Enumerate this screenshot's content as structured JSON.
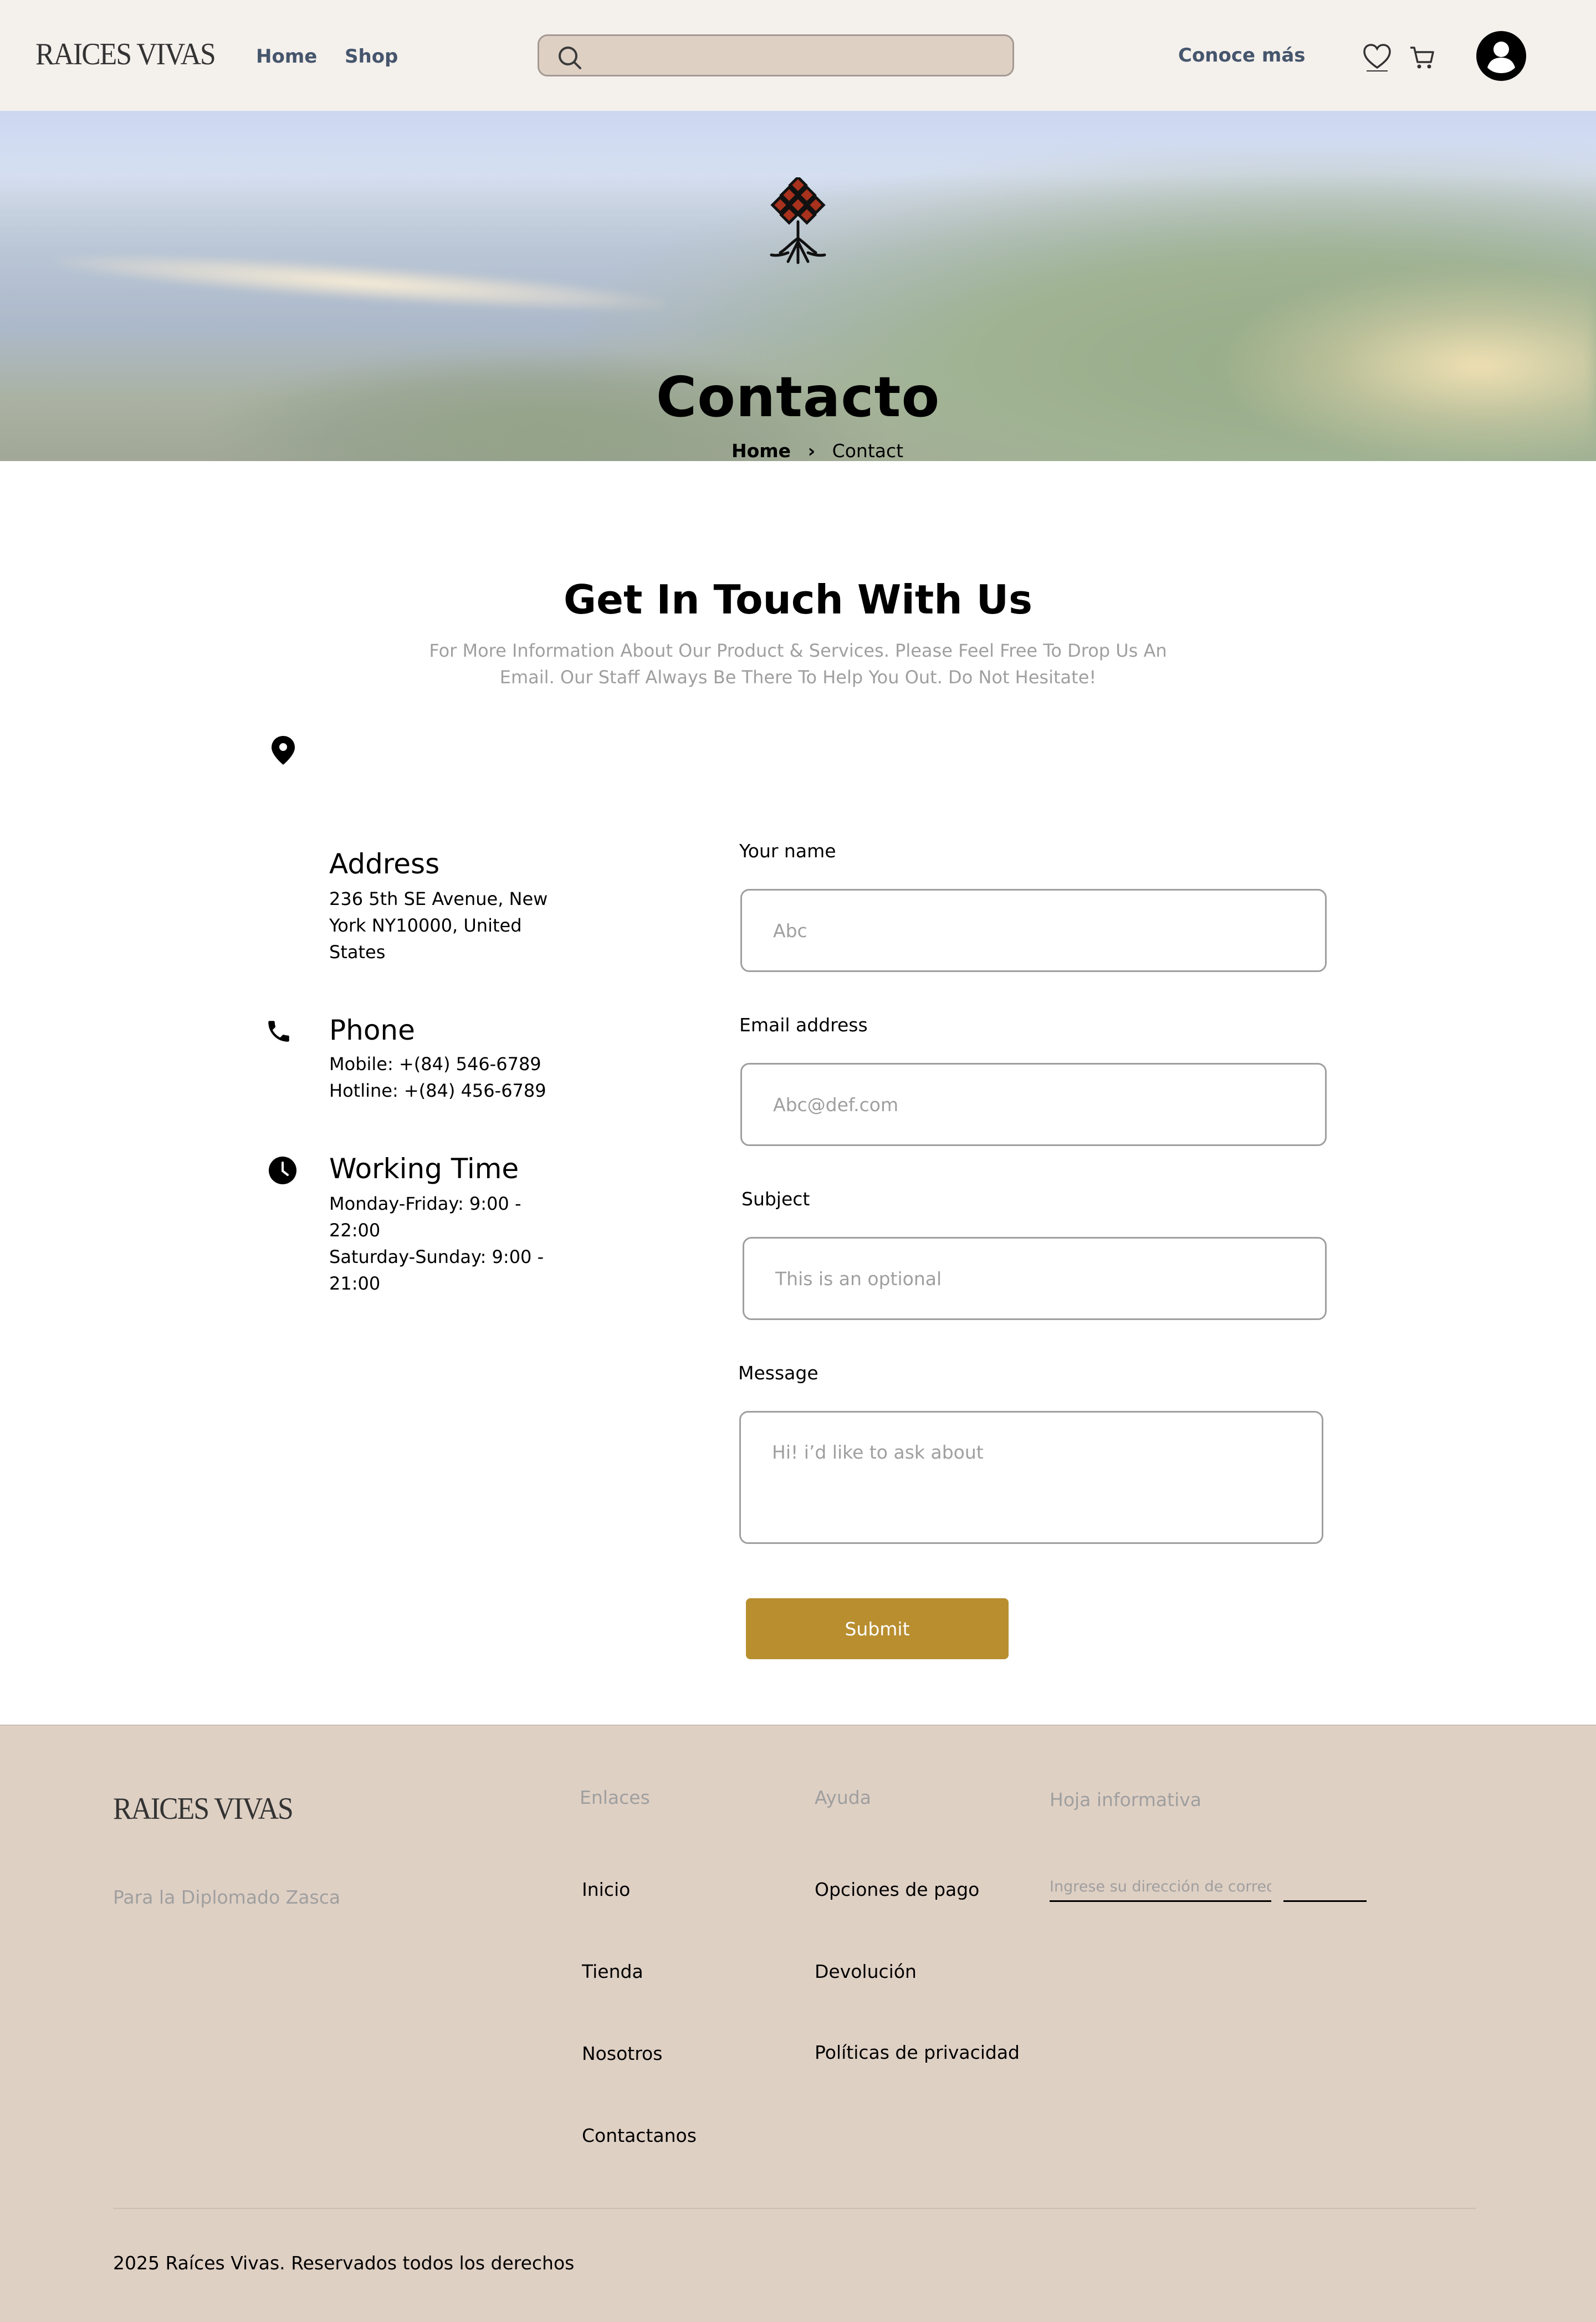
{
  "header": {
    "logo": "RAICES VIVAS",
    "nav": [
      "Home",
      "Shop"
    ],
    "search_placeholder": "",
    "conoce": "Conoce más"
  },
  "hero": {
    "title": "Contacto",
    "breadcrumb_home": "Home",
    "breadcrumb_current": "Contact"
  },
  "contact": {
    "heading": "Get In Touch With Us",
    "subtitle": "For More Information About Our Product & Services. Please Feel Free To Drop Us An Email. Our Staff Always Be There To Help You Out. Do Not Hesitate!",
    "address_title": "Address",
    "address_text": "236 5th SE Avenue, New York NY10000, United States",
    "phone_title": "Phone",
    "phone_mobile": "Mobile: +(84) 546-6789",
    "phone_hotline": "Hotline: +(84) 456-6789",
    "time_title": "Working Time",
    "time_weekday": "Monday-Friday: 9:00 - 22:00",
    "time_weekend": "Saturday-Sunday: 9:00 - 21:00"
  },
  "form": {
    "name_label": "Your name",
    "name_placeholder": "Abc",
    "email_label": "Email address",
    "email_placeholder": "Abc@def.com",
    "subject_label": "Subject",
    "subject_placeholder": "This is an optional",
    "message_label": "Message",
    "message_placeholder": "Hi! i’d like to ask about",
    "submit": "Submit"
  },
  "footer": {
    "logo": "RAICES VIVAS",
    "tagline": "Para la Diplomado Zasca",
    "links_heading": "Enlaces",
    "links": [
      "Inicio",
      "Tienda",
      "Nosotros",
      "Contactanos"
    ],
    "help_heading": "Ayuda",
    "help": [
      "Opciones de pago",
      "Devolución",
      "Políticas de privacidad"
    ],
    "newsletter_heading": "Hoja informativa",
    "newsletter_placeholder": "Ingrese su dirección de correo electrónico",
    "newsletter_button": "",
    "copyright": "2025 Raíces Vivas. Reservados todos los derechos"
  },
  "colors": {
    "header_bg": "#f4f0ec",
    "footer_bg": "#dfd0c4",
    "accent": "#b88e2f",
    "nav_text": "#45556c"
  },
  "icons": [
    "search-icon",
    "heart-icon",
    "cart-icon",
    "account-icon",
    "tree-emblem-icon",
    "chevron-right-icon",
    "location-pin-icon",
    "phone-icon",
    "clock-icon"
  ]
}
